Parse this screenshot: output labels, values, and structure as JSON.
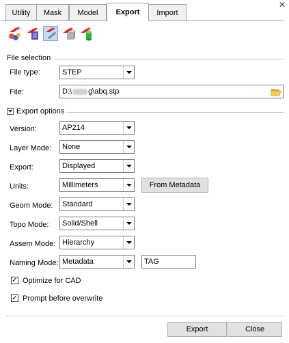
{
  "tabs": [
    {
      "label": "Utility",
      "active": false
    },
    {
      "label": "Mask",
      "active": false
    },
    {
      "label": "Model",
      "active": false
    },
    {
      "label": "Export",
      "active": true
    },
    {
      "label": "Import",
      "active": false
    }
  ],
  "toolbar": {
    "icons": [
      "export-spheres-icon",
      "export-book-icon",
      "export-pencil-icon",
      "export-box-icon",
      "export-cylinder-icon"
    ],
    "pressed_index": 2
  },
  "file_selection": {
    "title": "File selection",
    "file_type_label": "File type:",
    "file_type_value": "STEP",
    "file_label": "File:",
    "file_value_prefix": "D:\\",
    "file_value_suffix": "g\\abq.stp"
  },
  "export_options": {
    "title": "Export options",
    "version_label": "Version:",
    "version_value": "AP214",
    "layer_label": "Layer Mode:",
    "layer_value": "None",
    "export_label": "Export:",
    "export_value": "Displayed",
    "units_label": "Units:",
    "units_value": "Millimeters",
    "from_metadata_label": "From Metadata",
    "geom_label": "Geom Mode:",
    "geom_value": "Standard",
    "topo_label": "Topo Mode:",
    "topo_value": "Solid/Shell",
    "assem_label": "Assem Mode:",
    "assem_value": "Hierarchy",
    "naming_label": "Naming Mode:",
    "naming_value": "Metadata",
    "naming_tag": "TAG",
    "optimize_label": "Optimize for CAD",
    "optimize_checked": true,
    "prompt_label": "Prompt before overwrite",
    "prompt_checked": true
  },
  "footer": {
    "export_label": "Export",
    "close_label": "Close"
  },
  "colors": {
    "accent_pressed": "#c7dcf2",
    "arrow_red": "#d9262b"
  }
}
